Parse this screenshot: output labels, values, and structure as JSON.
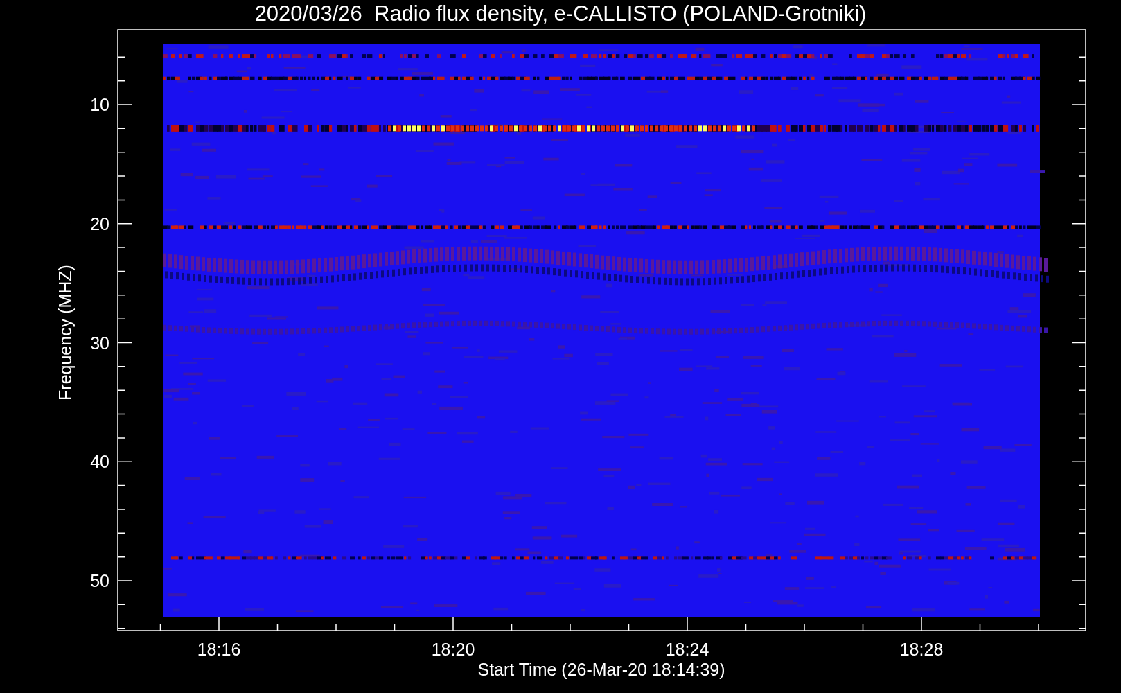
{
  "title": "2020/03/26  Radio flux density, e-CALLISTO (POLAND-Grotniki)",
  "y_axis": {
    "label": "Frequency (MHZ)",
    "ticks": [
      "10",
      "20",
      "30",
      "40",
      "50"
    ]
  },
  "x_axis": {
    "label": "Start Time (26-Mar-20 18:14:39)",
    "ticks": [
      "18:16",
      "18:20",
      "18:24",
      "18:28"
    ]
  }
}
